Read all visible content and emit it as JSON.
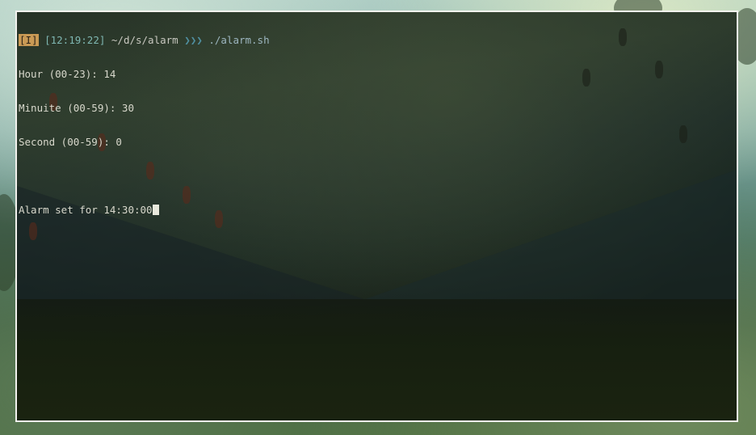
{
  "terminal": {
    "prompt": {
      "mode": "[I]",
      "time": "[12:19:22]",
      "path": "~/d/s/alarm",
      "arrows": "❯❯❯",
      "command": "./alarm.sh"
    },
    "output_lines": [
      "Hour (00-23): 14",
      "Minuite (00-59): 30",
      "Second (00-59): 0",
      "",
      "Alarm set for 14:30:00"
    ]
  },
  "colors": {
    "mode_badge_bg": "#c99a55",
    "time": "#7fb7b2",
    "arrows": "#4f8fa0",
    "text": "#d8d8cc",
    "window_border": "#f2f2ee"
  }
}
